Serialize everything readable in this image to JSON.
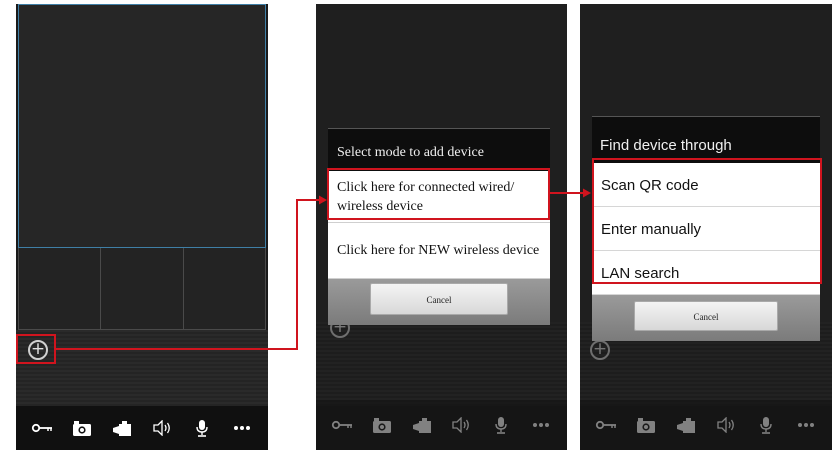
{
  "panel1": {
    "add_icon": "plus-circle-icon",
    "toolbar_icons": [
      "key-icon",
      "camera-icon",
      "video-camera-icon",
      "speaker-icon",
      "microphone-icon",
      "more-icon"
    ]
  },
  "panel2": {
    "dialog": {
      "title": "Select mode to add device",
      "options": [
        "Click here for connected wired/ wireless device",
        "Click here for NEW wireless device"
      ],
      "cancel_label": "Cancel"
    }
  },
  "panel3": {
    "dialog": {
      "title": "Find device through",
      "options": [
        "Scan QR code",
        "Enter manually",
        "LAN search"
      ],
      "cancel_label": "Cancel"
    }
  },
  "colors": {
    "highlight": "#d0141e",
    "accent_border": "#3f7fa6",
    "dialog_header": "#0d0d0d"
  }
}
